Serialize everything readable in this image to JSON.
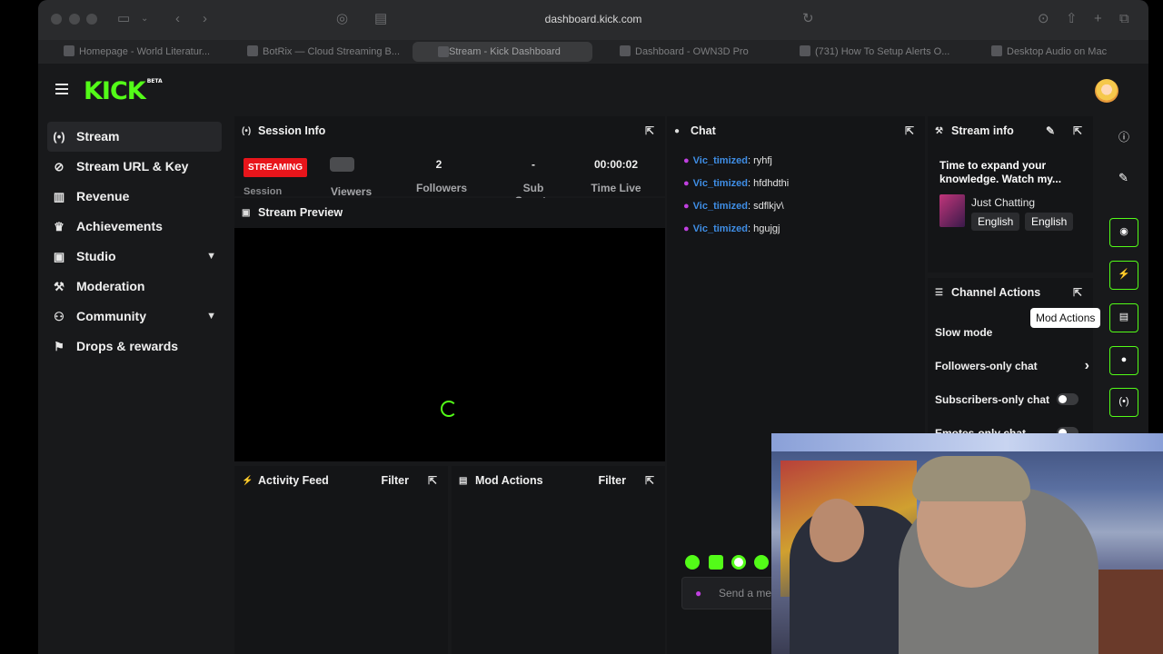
{
  "browser": {
    "url": "dashboard.kick.com",
    "tabs": [
      {
        "label": "Homepage - World Literatur..."
      },
      {
        "label": "BotRix — Cloud Streaming B..."
      },
      {
        "label": "Stream - Kick Dashboard"
      },
      {
        "label": "Dashboard - OWN3D Pro"
      },
      {
        "label": "(731) How To Setup Alerts O..."
      },
      {
        "label": "Desktop Audio on Mac"
      }
    ]
  },
  "app": {
    "logo": "KICK",
    "logo_badge": "BETA"
  },
  "sidebar": {
    "items": [
      {
        "label": "Stream",
        "icon": "broadcast-icon"
      },
      {
        "label": "Stream URL & Key",
        "icon": "link-icon"
      },
      {
        "label": "Revenue",
        "icon": "bar-chart-icon"
      },
      {
        "label": "Achievements",
        "icon": "trophy-icon"
      },
      {
        "label": "Studio",
        "icon": "film-icon"
      },
      {
        "label": "Moderation",
        "icon": "wrench-icon"
      },
      {
        "label": "Community",
        "icon": "users-icon"
      },
      {
        "label": "Drops & rewards",
        "icon": "gift-icon"
      }
    ]
  },
  "session": {
    "title": "Session Info",
    "status": "STREAMING",
    "session_label": "Session",
    "viewers_label": "Viewers",
    "followers_value": "2",
    "followers_label": "Followers",
    "subs_value": "-",
    "subs_label": "Sub Counts",
    "time_value": "00:00:02",
    "time_label": "Time Live"
  },
  "preview": {
    "title": "Stream Preview"
  },
  "activity": {
    "title": "Activity Feed",
    "filter": "Filter"
  },
  "modactions": {
    "title": "Mod Actions",
    "filter": "Filter"
  },
  "chat": {
    "title": "Chat",
    "messages": [
      {
        "user": "Vic_timized",
        "text": ": ryhfj"
      },
      {
        "user": "Vic_timized",
        "text": ": hfdhdthi"
      },
      {
        "user": "Vic_timized",
        "text": ": sdflkjv\\"
      },
      {
        "user": "Vic_timized",
        "text": ": hgujgj"
      }
    ],
    "input_placeholder": "Send a me"
  },
  "streaminfo": {
    "title": "Stream info",
    "stream_title": "Time to expand your knowledge. Watch my...",
    "category": "Just Chatting",
    "tags": [
      "English",
      "English"
    ]
  },
  "channel_actions": {
    "title": "Channel Actions",
    "slow_mode": "Slow mode",
    "followers_only": "Followers-only chat",
    "subscribers_only": "Subscribers-only chat",
    "emotes_only": "Emotes-only chat"
  },
  "tooltip": "Mod Actions",
  "colors": {
    "accent": "#53fc18",
    "live": "#e8151b",
    "username": "#3f8ee6"
  }
}
